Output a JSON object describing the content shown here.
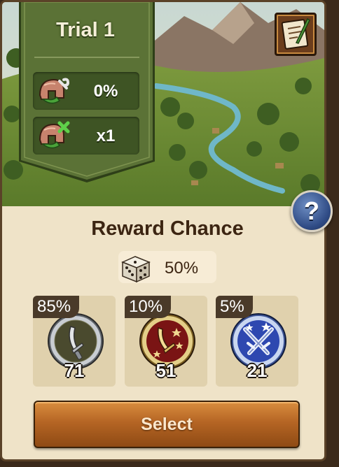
{
  "trial": {
    "title": "Trial 1",
    "stats": [
      {
        "icon": "helmet-wrench-icon",
        "value": "0%"
      },
      {
        "icon": "helmet-cross-icon",
        "value": "x1"
      }
    ]
  },
  "reward": {
    "title": "Reward Chance",
    "chance_icon": "dice-icon",
    "chance_value": "50%",
    "slots": [
      {
        "icon": "silver-sword-coin-icon",
        "percent": "85%",
        "count": "71"
      },
      {
        "icon": "red-sword-coin-icon",
        "percent": "10%",
        "count": "51"
      },
      {
        "icon": "blue-crossed-swords-coin-icon",
        "percent": "5%",
        "count": "21"
      }
    ]
  },
  "buttons": {
    "journal_icon": "journal-quill-icon",
    "help_label": "?",
    "select_label": "Select"
  },
  "colors": {
    "panel": "#efe3c8",
    "banner_green": "#5b7236",
    "select_button": "#b56524",
    "help_blue": "#2f4b85"
  }
}
